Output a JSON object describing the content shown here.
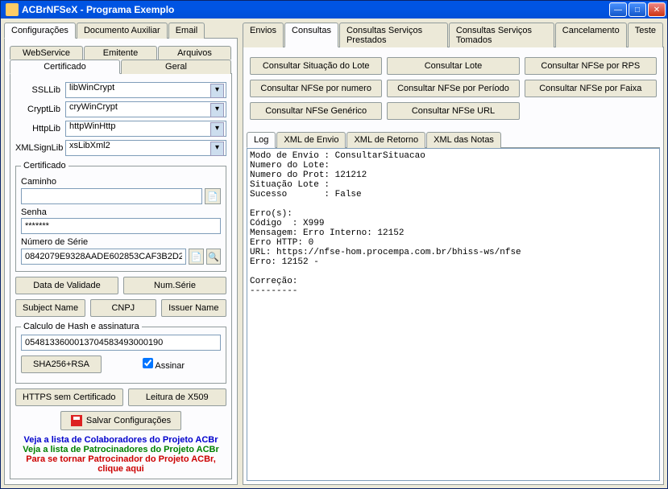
{
  "window": {
    "title": "ACBrNFSeX - Programa Exemplo"
  },
  "tabs_left": {
    "config": "Configurações",
    "docaux": "Documento Auxiliar",
    "email": "Email"
  },
  "subtabs_left_row1": {
    "webservice": "WebService",
    "emitente": "Emitente",
    "arquivos": "Arquivos"
  },
  "subtabs_left_row2": {
    "certificado": "Certificado",
    "geral": "Geral"
  },
  "fields": {
    "ssllib_label": "SSLLib",
    "ssllib_value": "libWinCrypt",
    "cryptlib_label": "CryptLib",
    "cryptlib_value": "cryWinCrypt",
    "httplib_label": "HttpLib",
    "httplib_value": "httpWinHttp",
    "xmlsignlib_label": "XMLSignLib",
    "xmlsignlib_value": "xsLibXml2"
  },
  "certificado": {
    "legend": "Certificado",
    "caminho_label": "Caminho",
    "caminho_value": "",
    "senha_label": "Senha",
    "senha_value": "*******",
    "numserie_label": "Número de Série",
    "numserie_value": "0842079E9328AADE602853CAF3B2D2"
  },
  "buttons": {
    "data_validade": "Data de Validade",
    "num_serie": "Num.Série",
    "subject_name": "Subject Name",
    "cnpj": "CNPJ",
    "issuer_name": "Issuer Name",
    "sha256rsa": "SHA256+RSA",
    "assinar": "Assinar",
    "https_sem_cert": "HTTPS sem Certificado",
    "leitura_x509": "Leitura de X509",
    "salvar_config": "Salvar Configurações"
  },
  "hash": {
    "legend": "Calculo de Hash e assinatura",
    "value": "0548133600013704583493000190"
  },
  "links": {
    "colaboradores": "Veja a lista de Colaboradores do Projeto ACBr",
    "patrocinadores": "Veja a lista de Patrocinadores do Projeto ACBr",
    "tornar_patroc": "Para se tornar Patrocinador do Projeto ACBr, clique aqui"
  },
  "tabs_right": {
    "envios": "Envios",
    "consultas": "Consultas",
    "serv_prestados": "Consultas Serviços Prestados",
    "serv_tomados": "Consultas Serviços Tomados",
    "cancelamento": "Cancelamento",
    "teste": "Teste"
  },
  "consult_buttons": {
    "sit_lote": "Consultar Situação do Lote",
    "lote": "Consultar Lote",
    "nfse_rps": "Consultar NFSe por RPS",
    "nfse_numero": "Consultar NFSe por numero",
    "nfse_periodo": "Consultar NFSe por Período",
    "nfse_faixa": "Consultar NFSe por Faixa",
    "nfse_generico": "Consultar NFSe Genérico",
    "nfse_url": "Consultar NFSe URL"
  },
  "log_tabs": {
    "log": "Log",
    "xml_envio": "XML de Envio",
    "xml_retorno": "XML de Retorno",
    "xml_notas": "XML das Notas"
  },
  "log_text": "Modo de Envio : ConsultarSituacao\nNumero do Lote:\nNumero do Prot: 121212\nSituação Lote :\nSucesso       : False\n\nErro(s):\nCódigo  : X999\nMensagem: Erro Interno: 12152\nErro HTTP: 0\nURL: https://nfse-hom.procempa.com.br/bhiss-ws/nfse\nErro: 12152 -\n\nCorreção:\n---------"
}
